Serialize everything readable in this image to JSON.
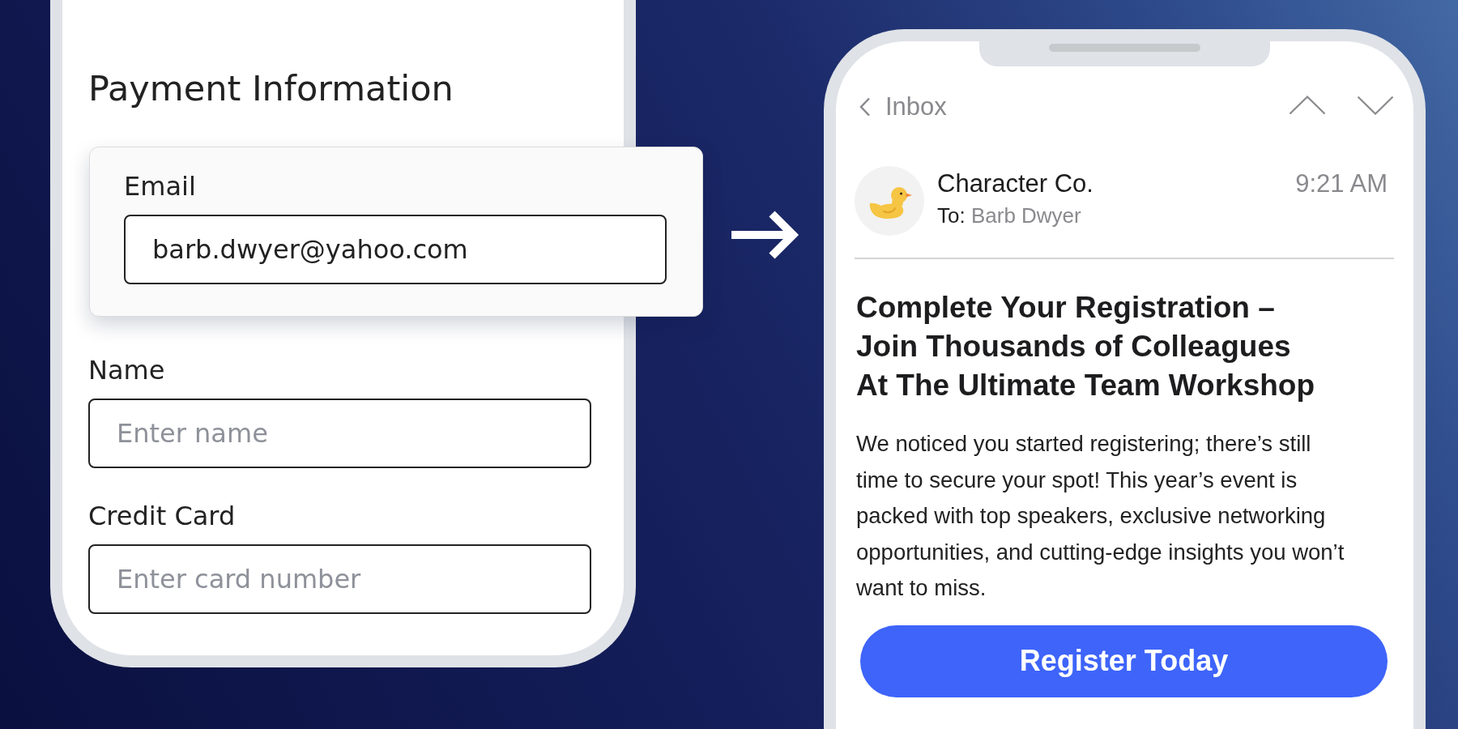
{
  "payment_form": {
    "title": "Payment Information",
    "fields": [
      {
        "label": "Email",
        "value": "barb.dwyer@yahoo.com",
        "highlighted": true
      },
      {
        "label": "Name",
        "placeholder": "Enter name",
        "highlighted": false
      },
      {
        "label": "Credit Card",
        "placeholder": "Enter card number",
        "highlighted": false
      }
    ]
  },
  "email": {
    "back_label": "Inbox",
    "sender": "Character Co.",
    "time": "9:21 AM",
    "to_label": "To:",
    "recipient": "Barb Dwyer",
    "subject": "Complete Your Registration –\nJoin Thousands of Colleagues\nAt The Ultimate Team Workshop",
    "body": "We noticed you started registering; there’s still\ntime to secure your spot! This year’s event is\npacked with top speakers, exclusive networking\nopportunities, and cutting-edge insights you won’t\nwant to miss.",
    "button": "Register Today"
  }
}
